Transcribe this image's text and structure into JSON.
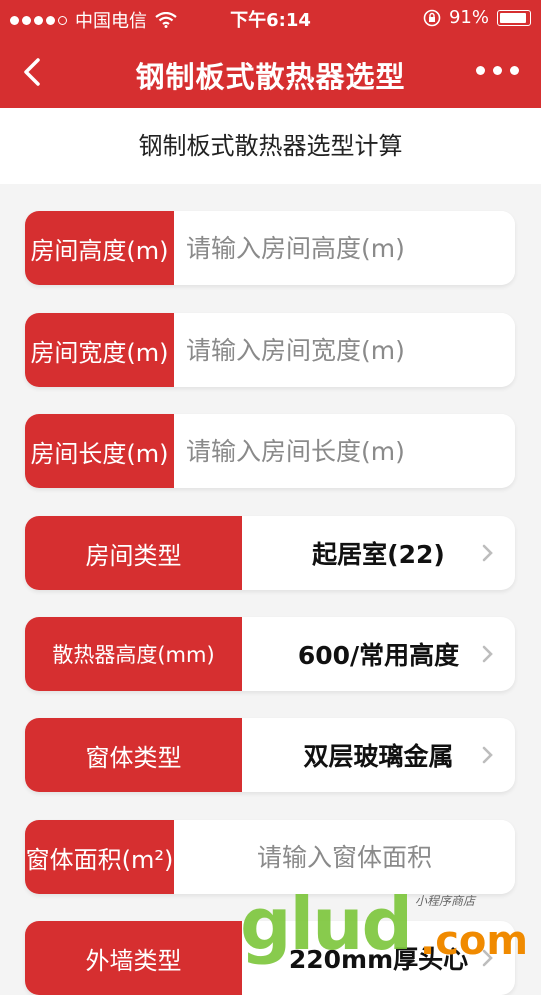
{
  "status_bar": {
    "carrier": "中国电信",
    "time": "下午6:14",
    "battery": "91%"
  },
  "nav": {
    "title": "钢制板式散热器选型"
  },
  "subheader": "钢制板式散热器选型计算",
  "form": {
    "room_height": {
      "label": "房间高度(m)",
      "placeholder": "请输入房间高度(m)"
    },
    "room_width": {
      "label": "房间宽度(m)",
      "placeholder": "请输入房间宽度(m)"
    },
    "room_length": {
      "label": "房间长度(m)",
      "placeholder": "请输入房间长度(m)"
    },
    "room_type": {
      "label": "房间类型",
      "value": "起居室(22)"
    },
    "radiator_height": {
      "label": "散热器高度(mm)",
      "value": "600/常用高度"
    },
    "window_type": {
      "label": "窗体类型",
      "value": "双层玻璃金属"
    },
    "window_area": {
      "label": "窗体面积(m²)",
      "placeholder": "请输入窗体面积"
    },
    "wall_type": {
      "label": "外墙类型",
      "value": "220mm厚头心"
    }
  },
  "watermark": {
    "logo": "glud",
    "domain": ".com",
    "tagline": "小程序商店"
  },
  "colors": {
    "primary": "#d62f30",
    "background": "#f4f4f4"
  }
}
